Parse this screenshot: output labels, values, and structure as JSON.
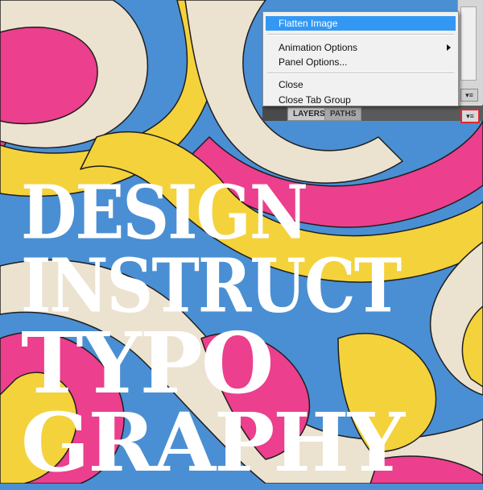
{
  "artwork": {
    "headline_lines": [
      "DESIGN",
      "INSTRUCT",
      "TYPO",
      "GRAPHY"
    ],
    "colors": {
      "blue": "#4a8fd3",
      "pink": "#ec3f8d",
      "yellow": "#f4d23b",
      "cream": "#ece2d0",
      "outline": "#1e1e1e",
      "text": "#ffffff"
    }
  },
  "context_menu": {
    "items": [
      {
        "label": "Flatten Image",
        "highlighted": true
      },
      {
        "label": "Animation Options",
        "has_submenu": true
      },
      {
        "label": "Panel Options..."
      },
      {
        "label": "Close"
      },
      {
        "label": "Close Tab Group"
      }
    ]
  },
  "panel": {
    "tabs": [
      {
        "label": "LAYERS",
        "active": true
      },
      {
        "label": "PATHS",
        "active": false
      }
    ],
    "flyout_icon": "panel-menu-icon",
    "highlight_color": "#e0282f"
  }
}
